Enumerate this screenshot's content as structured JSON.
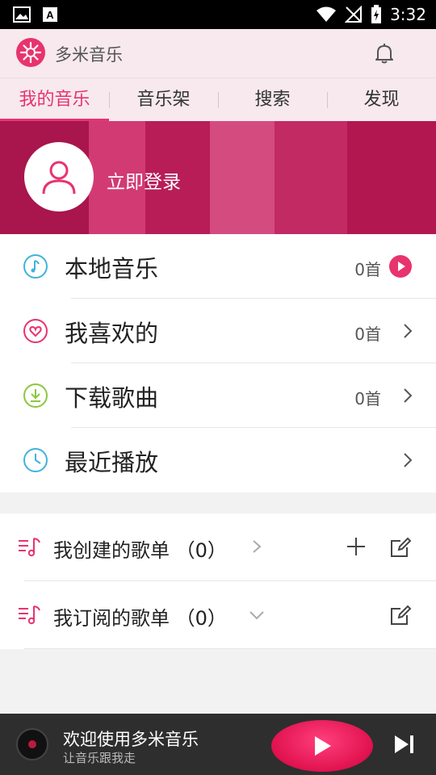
{
  "status_bar": {
    "time": "3:32"
  },
  "app": {
    "title": "多米音乐"
  },
  "tabs": [
    {
      "label": "我的音乐",
      "active": true
    },
    {
      "label": "音乐架",
      "active": false
    },
    {
      "label": "搜索",
      "active": false
    },
    {
      "label": "发现",
      "active": false
    }
  ],
  "banner": {
    "login_label": "立即登录"
  },
  "menu": [
    {
      "label": "本地音乐",
      "count": "0首",
      "icon": "music-note-icon",
      "action": "play-icon"
    },
    {
      "label": "我喜欢的",
      "count": "0首",
      "icon": "heart-icon",
      "action": "chevron-right-icon"
    },
    {
      "label": "下载歌曲",
      "count": "0首",
      "icon": "download-icon",
      "action": "chevron-right-icon"
    },
    {
      "label": "最近播放",
      "count": "",
      "icon": "clock-icon",
      "action": "chevron-right-icon"
    }
  ],
  "playlists": [
    {
      "label": "我创建的歌单 （0）",
      "arrow": "chevron-right-icon"
    },
    {
      "label": "我订阅的歌单 （0）",
      "arrow": "chevron-down-icon"
    }
  ],
  "player": {
    "title": "欢迎使用多米音乐",
    "subtitle": "让音乐跟我走"
  },
  "colors": {
    "accent": "#e8336e",
    "banner": "#c51a5d",
    "player_bg": "#2e2e2e",
    "tab_bg": "#f7e9ee"
  }
}
